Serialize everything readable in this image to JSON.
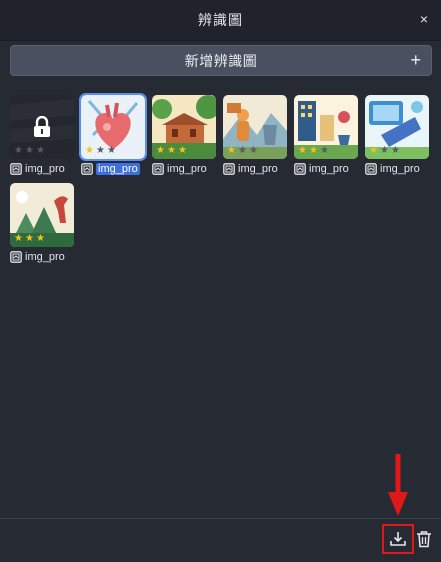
{
  "window": {
    "title": "辨識圖",
    "close_label": "×"
  },
  "add_button": {
    "label": "新增辨識圖",
    "plus": "+"
  },
  "images": [
    {
      "name": "img_pro",
      "stars": 0,
      "max_stars": 3,
      "locked": true,
      "selected": false,
      "thumb": "locked-dark"
    },
    {
      "name": "img_pro",
      "stars": 1,
      "max_stars": 3,
      "locked": false,
      "selected": true,
      "thumb": "heart"
    },
    {
      "name": "img_pro",
      "stars": 3,
      "max_stars": 3,
      "locked": false,
      "selected": false,
      "thumb": "jungle-hut"
    },
    {
      "name": "img_pro",
      "stars": 1,
      "max_stars": 3,
      "locked": false,
      "selected": false,
      "thumb": "hiker"
    },
    {
      "name": "img_pro",
      "stars": 2,
      "max_stars": 3,
      "locked": false,
      "selected": false,
      "thumb": "city"
    },
    {
      "name": "img_pro",
      "stars": 1,
      "max_stars": 3,
      "locked": false,
      "selected": false,
      "thumb": "tech"
    },
    {
      "name": "img_pro",
      "stars": 3,
      "max_stars": 3,
      "locked": false,
      "selected": false,
      "thumb": "dinosaur"
    }
  ],
  "toolbar": {
    "export_icon": "download-icon",
    "delete_icon": "trash-icon"
  },
  "colors": {
    "accent": "#5b8def",
    "star": "#f2c318",
    "highlight": "#e01818"
  }
}
